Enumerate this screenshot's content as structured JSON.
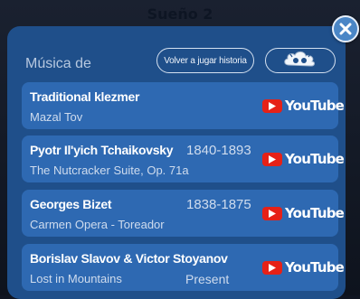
{
  "background_title": "Sueño 2",
  "header": {
    "label": "Música de",
    "replay_label": "Volver a jugar historia"
  },
  "colors": {
    "panel": "#1f4f8a",
    "row": "#2e69b2",
    "youtube_red": "#e62117",
    "close_button": "#4a86c6"
  },
  "tracks": [
    {
      "artist": "Traditional klezmer",
      "years": "",
      "piece": "Mazal Tov",
      "extra": "",
      "link_label": "YouTube"
    },
    {
      "artist": "Pyotr Il'yich Tchaikovsky",
      "years": "1840-1893",
      "piece": "The Nutcracker Suite, Op. 71a",
      "extra": "",
      "link_label": "YouTube"
    },
    {
      "artist": "Georges Bizet",
      "years": "1838-1875",
      "piece": "Carmen Opera - Toreador",
      "extra": "",
      "link_label": "YouTube"
    },
    {
      "artist": "Borislav Slavov & Victor Stoyanov",
      "years": "",
      "piece": "Lost in Mountains",
      "extra": "Present",
      "link_label": "YouTube"
    }
  ]
}
